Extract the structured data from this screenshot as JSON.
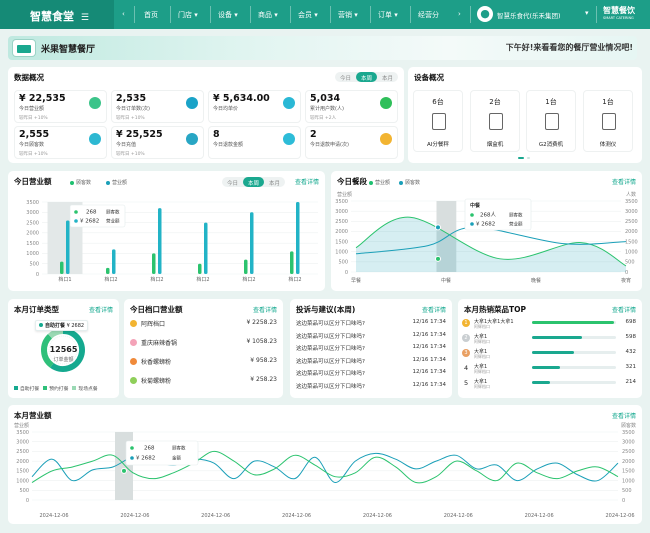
{
  "nav": {
    "brand": "智慧食堂",
    "items": [
      "首页",
      "门店",
      "设备",
      "商品",
      "会员",
      "营销",
      "订单",
      "经营分"
    ],
    "user": "智慧乐食代(乐禾集团)",
    "logo_text": "智慧餐饮",
    "logo_sub": "SMART CATERING"
  },
  "banner": {
    "store": "米果智慧餐厅",
    "greeting": "下午好!来看看您的餐厅营业情况吧!"
  },
  "overview": {
    "title": "数据概况",
    "tabs": [
      "今日",
      "本周",
      "本月"
    ],
    "active_tab": "本周",
    "kpis": [
      {
        "value": "¥ 22,535",
        "label": "今日营业额",
        "sub": "较昨日 +10%"
      },
      {
        "value": "2,535",
        "label": "今日订单数(次)",
        "sub": "较昨日 +10%"
      },
      {
        "value": "¥ 5,634.00",
        "label": "今日均单价",
        "sub": ""
      },
      {
        "value": "5,034",
        "label": "累计用户数(人)",
        "sub": "较昨日 +2人"
      },
      {
        "value": "2,555",
        "label": "今日顾客数",
        "sub": "较昨日 +10%"
      },
      {
        "value": "¥ 25,525",
        "label": "今日充值",
        "sub": "较昨日 +10%"
      },
      {
        "value": "8",
        "label": "今日退款金额",
        "sub": ""
      },
      {
        "value": "2",
        "label": "今日退款申请(次)",
        "sub": ""
      }
    ],
    "kpi_icon_colors": [
      "#3cc48a",
      "#1aa3c8",
      "#2ab8d5",
      "#2fbf5a",
      "#2db8d2",
      "#28a6c4",
      "#2dbcd8",
      "#f2b431"
    ]
  },
  "devices": {
    "title": "设备概况",
    "items": [
      {
        "count": "6台",
        "name": "AI分餐秤"
      },
      {
        "count": "2台",
        "name": "烟盒机"
      },
      {
        "count": "1台",
        "name": "G2消费机"
      },
      {
        "count": "1台",
        "name": "体测仪"
      }
    ]
  },
  "today_revenue": {
    "title": "今日营业额",
    "tabs": [
      "今日",
      "本周",
      "本月"
    ],
    "active_tab": "本周",
    "more": "查看详情",
    "legend": [
      "顾客数",
      "营业额"
    ],
    "tooltip": {
      "v1": "268",
      "l1": "顾客数",
      "v2": "¥ 2682",
      "l2": "营业额"
    }
  },
  "today_meal": {
    "title": "今日餐段",
    "more": "查看详情",
    "legend": [
      "营业额",
      "顾客数"
    ],
    "left_unit": "营业额",
    "right_unit": "人数",
    "tooltip": {
      "title": "中餐",
      "v1": "268人",
      "l1": "顾客数",
      "v2": "¥ 2682",
      "l2": "营业额"
    }
  },
  "order_type": {
    "title": "本月订单类型",
    "more": "查看详情",
    "center_value": "12565",
    "center_label": "订单金额",
    "tip_label": "自助打餐",
    "tip_value": "¥ 2682",
    "legend": [
      "自助打餐",
      "预约打餐",
      "现场点餐"
    ],
    "colors": [
      "#15a98f",
      "#2fc07a",
      "#9ad9b4"
    ]
  },
  "stall_revenue": {
    "title": "今日档口营业额",
    "more": "查看详情",
    "rows": [
      {
        "name": "阿辉档口",
        "value": "¥ 2258.23"
      },
      {
        "name": "重庆麻辣香锅",
        "value": "¥ 1058.23"
      },
      {
        "name": "秋香螺蛳粉",
        "value": "¥ 958.23"
      },
      {
        "name": "秋菊螺蛳粉",
        "value": "¥ 258.23"
      }
    ]
  },
  "complaints": {
    "title": "投诉与建议(本周)",
    "more": "查看详情",
    "rows": [
      {
        "text": "这边菜品可以区分下口味吗?",
        "time": "12/16 17:34"
      },
      {
        "text": "这边菜品可以区分下口味吗?",
        "time": "12/16 17:34"
      },
      {
        "text": "这边菜品可以区分下口味吗?",
        "time": "12/16 17:34"
      },
      {
        "text": "这边菜品可以区分下口味吗?",
        "time": "12/16 17:34"
      },
      {
        "text": "这边菜品可以区分下口味吗?",
        "time": "12/16 17:34"
      },
      {
        "text": "这边菜品可以区分下口味吗?",
        "time": "12/16 17:34"
      }
    ]
  },
  "top_dishes": {
    "title": "本月热销菜品TOP",
    "more": "查看详情",
    "rows": [
      {
        "rank": "1",
        "name": "大拿1大拿1大拿1",
        "sub": "阿辉档口",
        "value": "698",
        "pct": 0.98
      },
      {
        "rank": "2",
        "name": "大拿1",
        "sub": "阿辉档口",
        "value": "598",
        "pct": 0.6
      },
      {
        "rank": "3",
        "name": "大拿1",
        "sub": "阿辉档口",
        "value": "432",
        "pct": 0.5
      },
      {
        "rank": "4",
        "name": "大拿1",
        "sub": "阿辉档口",
        "value": "321",
        "pct": 0.33
      },
      {
        "rank": "5",
        "name": "大拿1",
        "sub": "阿辉档口",
        "value": "214",
        "pct": 0.22
      }
    ]
  },
  "month_revenue": {
    "title": "本月营业额",
    "more": "查看详情",
    "left_unit": "营业额",
    "right_unit": "顾客数",
    "tooltip": {
      "v1": "268",
      "l1": "顾客数",
      "v2": "¥ 2682",
      "l2": "金额"
    }
  },
  "chart_data": [
    {
      "type": "bar",
      "title": "今日营业额",
      "categories": [
        "档口1",
        "档口2",
        "档口2",
        "档口2",
        "档口2",
        "档口2"
      ],
      "series": [
        {
          "name": "顾客数",
          "values": [
            600,
            300,
            1000,
            500,
            700,
            1100
          ]
        },
        {
          "name": "营业额",
          "values": [
            2600,
            1200,
            3200,
            2500,
            3000,
            3500
          ]
        }
      ],
      "ylim": [
        0,
        3500
      ],
      "yticks": [
        0,
        500,
        1000,
        1500,
        2000,
        2500,
        3000,
        3500
      ]
    },
    {
      "type": "line",
      "title": "今日餐段",
      "categories": [
        "早餐",
        "中餐",
        "晚餐",
        "夜宵"
      ],
      "series": [
        {
          "name": "营业额",
          "x": [
            0,
            0.6,
            1.6,
            2.5,
            3
          ],
          "values": [
            1200,
            2700,
            650,
            1450,
            300
          ]
        },
        {
          "name": "顾客数",
          "x": [
            0,
            0.8,
            1.3,
            2.3,
            3
          ],
          "values": [
            900,
            1300,
            2200,
            1400,
            1500
          ]
        }
      ],
      "ylim": [
        0,
        3500
      ],
      "yticks": [
        0,
        500,
        1000,
        1500,
        2000,
        2500,
        3000,
        3500
      ]
    },
    {
      "type": "pie",
      "title": "本月订单类型",
      "categories": [
        "自助打餐",
        "预约打餐",
        "现场点餐"
      ],
      "values": [
        60,
        28,
        12
      ]
    },
    {
      "type": "line",
      "title": "本月营业额",
      "categories": [
        "2024-12-06",
        "2024-12-06",
        "2024-12-06",
        "2024-12-06",
        "2024-12-06",
        "2024-12-06",
        "2024-12-06",
        "2024-12-06"
      ],
      "series": [
        {
          "name": "营业额",
          "values": [
            1200,
            2100,
            1000,
            1550,
            1700,
            2200,
            2000,
            1800,
            2100,
            1900,
            1100,
            2000,
            1700,
            1100,
            2200,
            900,
            2000,
            2400,
            2100,
            1600,
            2000,
            2300,
            1600,
            1800,
            1000,
            1600,
            1900,
            1300,
            1000,
            1900
          ]
        },
        {
          "name": "顾客数",
          "values": [
            900,
            1500,
            1700,
            2000,
            2300,
            1400,
            1100,
            1400,
            1900,
            2500,
            2000,
            1300,
            1600,
            2300,
            1800,
            1200,
            1400,
            2200,
            1700,
            900,
            1200,
            2000,
            1500,
            1000,
            1900,
            1400,
            1100,
            1500,
            1700,
            1200
          ]
        }
      ],
      "ylim": [
        0,
        3500
      ],
      "yticks": [
        0,
        500,
        1000,
        1500,
        2000,
        2500,
        3000,
        3500
      ]
    }
  ]
}
